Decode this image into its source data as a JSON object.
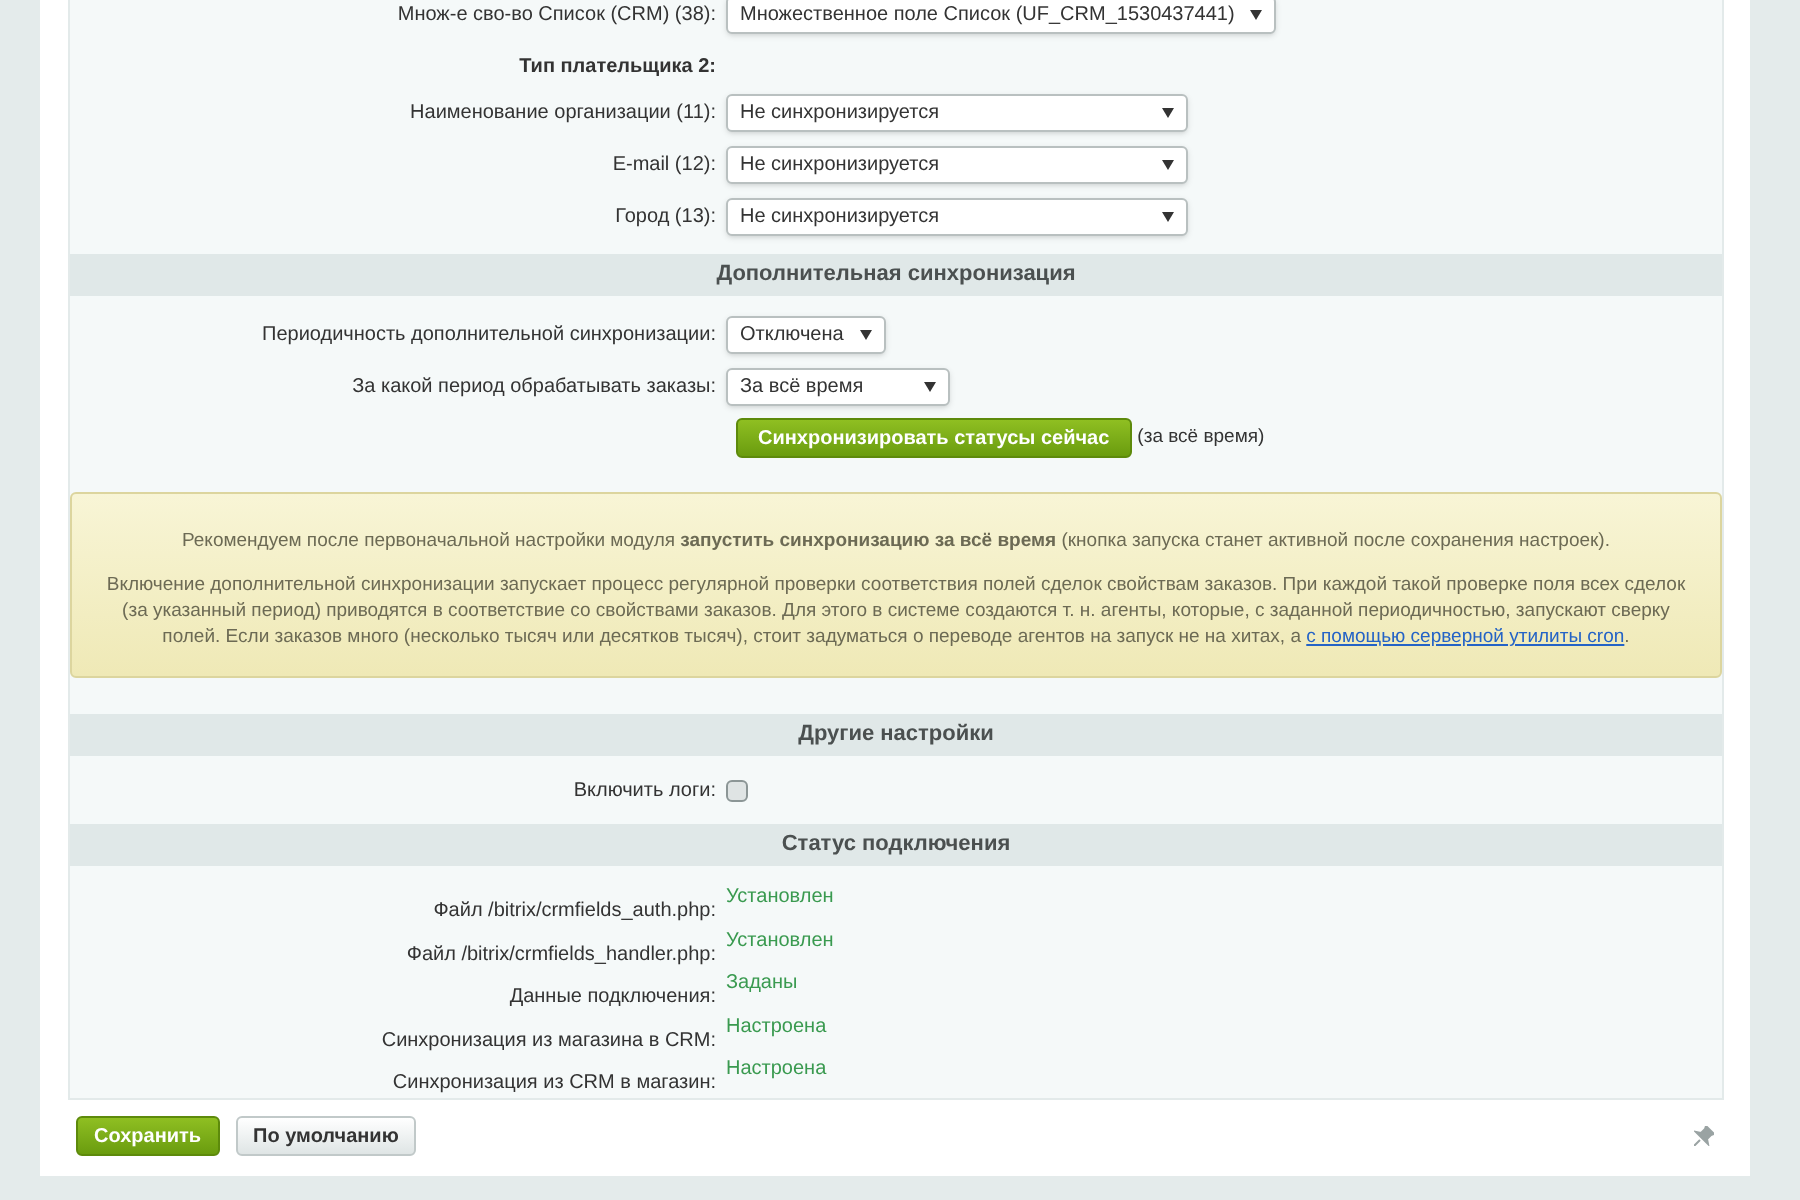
{
  "rows_top": [
    {
      "kind": "select",
      "label": "Множ-е сво-во Список (CRM) (38):",
      "value": "Множественное поле Список (UF_CRM_1530437441)"
    },
    {
      "kind": "subheading",
      "label": "Тип плательщика 2:"
    },
    {
      "kind": "select",
      "label": "Наименование организации (11):",
      "value": "Не синхронизируется"
    },
    {
      "kind": "select",
      "label": "E-mail (12):",
      "value": "Не синхронизируется"
    },
    {
      "kind": "select",
      "label": "Город (13):",
      "value": "Не синхронизируется"
    }
  ],
  "extra_sync": {
    "heading": "Дополнительная синхронизация",
    "rows": [
      {
        "label": "Периодичность дополнительной синхронизации:",
        "value": "Отключена"
      },
      {
        "label": "За какой период обрабатывать заказы:",
        "value": "За всё время"
      }
    ],
    "sync_button": "Синхронизировать статусы сейчас",
    "sync_note": "(за всё время)"
  },
  "notice": {
    "line1": "Рекомендуем после первоначальной настройки модуля **запустить синхронизацию за всё время** (кнопка запуска станет активной после сохранения настроек).",
    "line2": "Включение дополнительной синхронизации запускает процесс регулярной проверки соответствия полей сделок свойствам заказов. При каждой такой проверке поля всех сделок (за указанный период) приводятся в соответствие со свойствами заказов. Для этого в системе создаются т. н. агенты, которые, с заданной периодичностью, запускают сверку полей. Если заказов много (несколько тысяч или десятков тысяч), стоит задуматься о переводе агентов на запуск не на хитах, а",
    "link": "с помощью серверной утилиты cron",
    "end": "."
  },
  "other": {
    "heading": "Другие настройки",
    "log_label": "Включить логи:",
    "log_checked": false
  },
  "status": {
    "heading": "Статус подключения",
    "rows": [
      {
        "label": "Файл /bitrix/crmfields_auth.php:",
        "value": "Установлен"
      },
      {
        "label": "Файл /bitrix/crmfields_handler.php:",
        "value": "Установлен"
      },
      {
        "label": "Данные подключения:",
        "value": "Заданы"
      },
      {
        "label": "Синхронизация из магазина в CRM:",
        "value": "Настроена"
      },
      {
        "label": "Синхронизация из CRM в магазин:",
        "value": "Настроена"
      }
    ]
  },
  "footer": {
    "save": "Сохранить",
    "default": "По умолчанию"
  }
}
